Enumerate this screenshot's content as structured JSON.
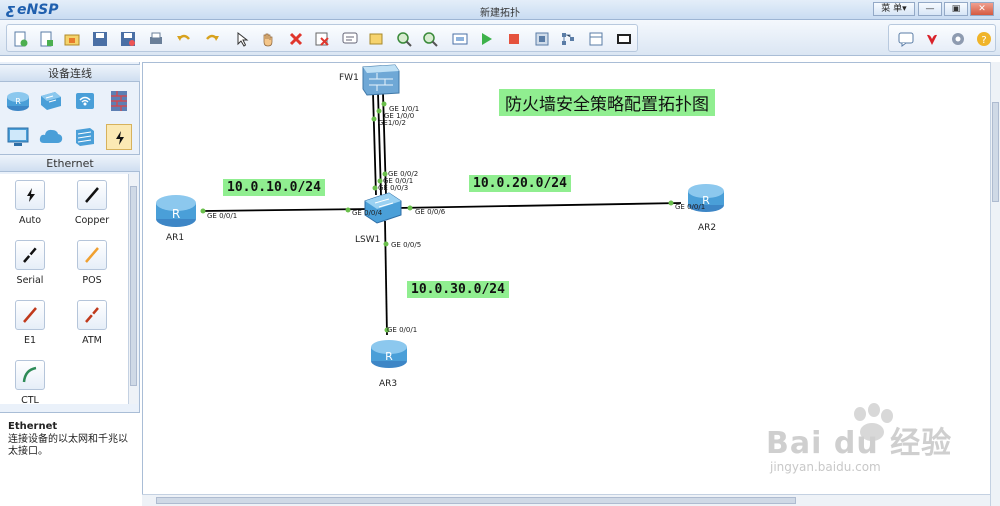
{
  "app": {
    "logo": "eNSP",
    "window_title": "新建拓扑",
    "menu_label": "菜 单▾"
  },
  "window_buttons": {
    "minimize": "—",
    "restore": "▣",
    "close": "✕"
  },
  "toolbar": {
    "left_icons": [
      "new-topology-icon",
      "new-example-icon",
      "open-icon",
      "save-icon",
      "save-as-icon",
      "print-icon",
      "undo-icon",
      "redo-icon",
      "select-icon",
      "pan-hand-icon",
      "delete-icon",
      "delete-link-icon",
      "text-icon",
      "rectangle-icon",
      "zoom-in-icon",
      "zoom-out-icon",
      "fit-screen-icon",
      "start-device-icon",
      "stop-device-icon",
      "capture-icon",
      "topology-icon",
      "grid-icon",
      "screenshot-icon"
    ],
    "right_icons": [
      "feedback-icon",
      "huawei-icon",
      "settings-icon",
      "help-icon"
    ]
  },
  "left_panel": {
    "device_header": "设备连线",
    "devices": [
      "router-icon",
      "switch-icon",
      "wlan-icon",
      "firewall-icon",
      "pc-icon",
      "cloud-icon",
      "server-icon",
      "connection-icon"
    ],
    "cable_header": "Ethernet",
    "cables": [
      {
        "label": "Auto",
        "icon": "auto-cable-icon",
        "color": "#111111"
      },
      {
        "label": "Copper",
        "icon": "copper-cable-icon",
        "color": "#111111"
      },
      {
        "label": "Serial",
        "icon": "serial-cable-icon",
        "color": "#111111"
      },
      {
        "label": "POS",
        "icon": "pos-cable-icon",
        "color": "#f0a030"
      },
      {
        "label": "E1",
        "icon": "e1-cable-icon",
        "color": "#c0391b"
      },
      {
        "label": "ATM",
        "icon": "atm-cable-icon",
        "color": "#c0391b"
      },
      {
        "label": "CTL",
        "icon": "ctl-cable-icon",
        "color": "#2e8b57"
      }
    ],
    "description": {
      "title": "Ethernet",
      "text": "连接设备的以太网和千兆以太接口。"
    }
  },
  "topology": {
    "title": "防火墙安全策略配置拓扑图",
    "networks": [
      "10.0.10.0/24",
      "10.0.20.0/24",
      "10.0.30.0/24"
    ],
    "devices": {
      "fw1": "FW1",
      "lsw1": "LSW1",
      "ar1": "AR1",
      "ar2": "AR2",
      "ar3": "AR3"
    },
    "ports": {
      "fw_1": "GE 1/0/1",
      "fw_0": "GE 1/0/0",
      "fw_2": "GE1/0/2",
      "sw_2": "GE 0/0/2",
      "sw_1": "GE 0/0/1",
      "sw_3": "GE 0/0/3",
      "sw_4": "GE 0/0/4",
      "sw_6": "GE 0/0/6",
      "sw_5": "GE 0/0/5",
      "ar1": "GE 0/0/1",
      "ar2": "GE 0/0/1",
      "ar3": "GE 0/0/1"
    }
  },
  "watermark": {
    "brand": "Bai du 经验",
    "url": "jingyan.baidu.com"
  },
  "colors": {
    "link": "#000000",
    "port_dot": "#6abf4b",
    "net_label_bg": "#90ee90",
    "router": "#4a9fd8"
  }
}
